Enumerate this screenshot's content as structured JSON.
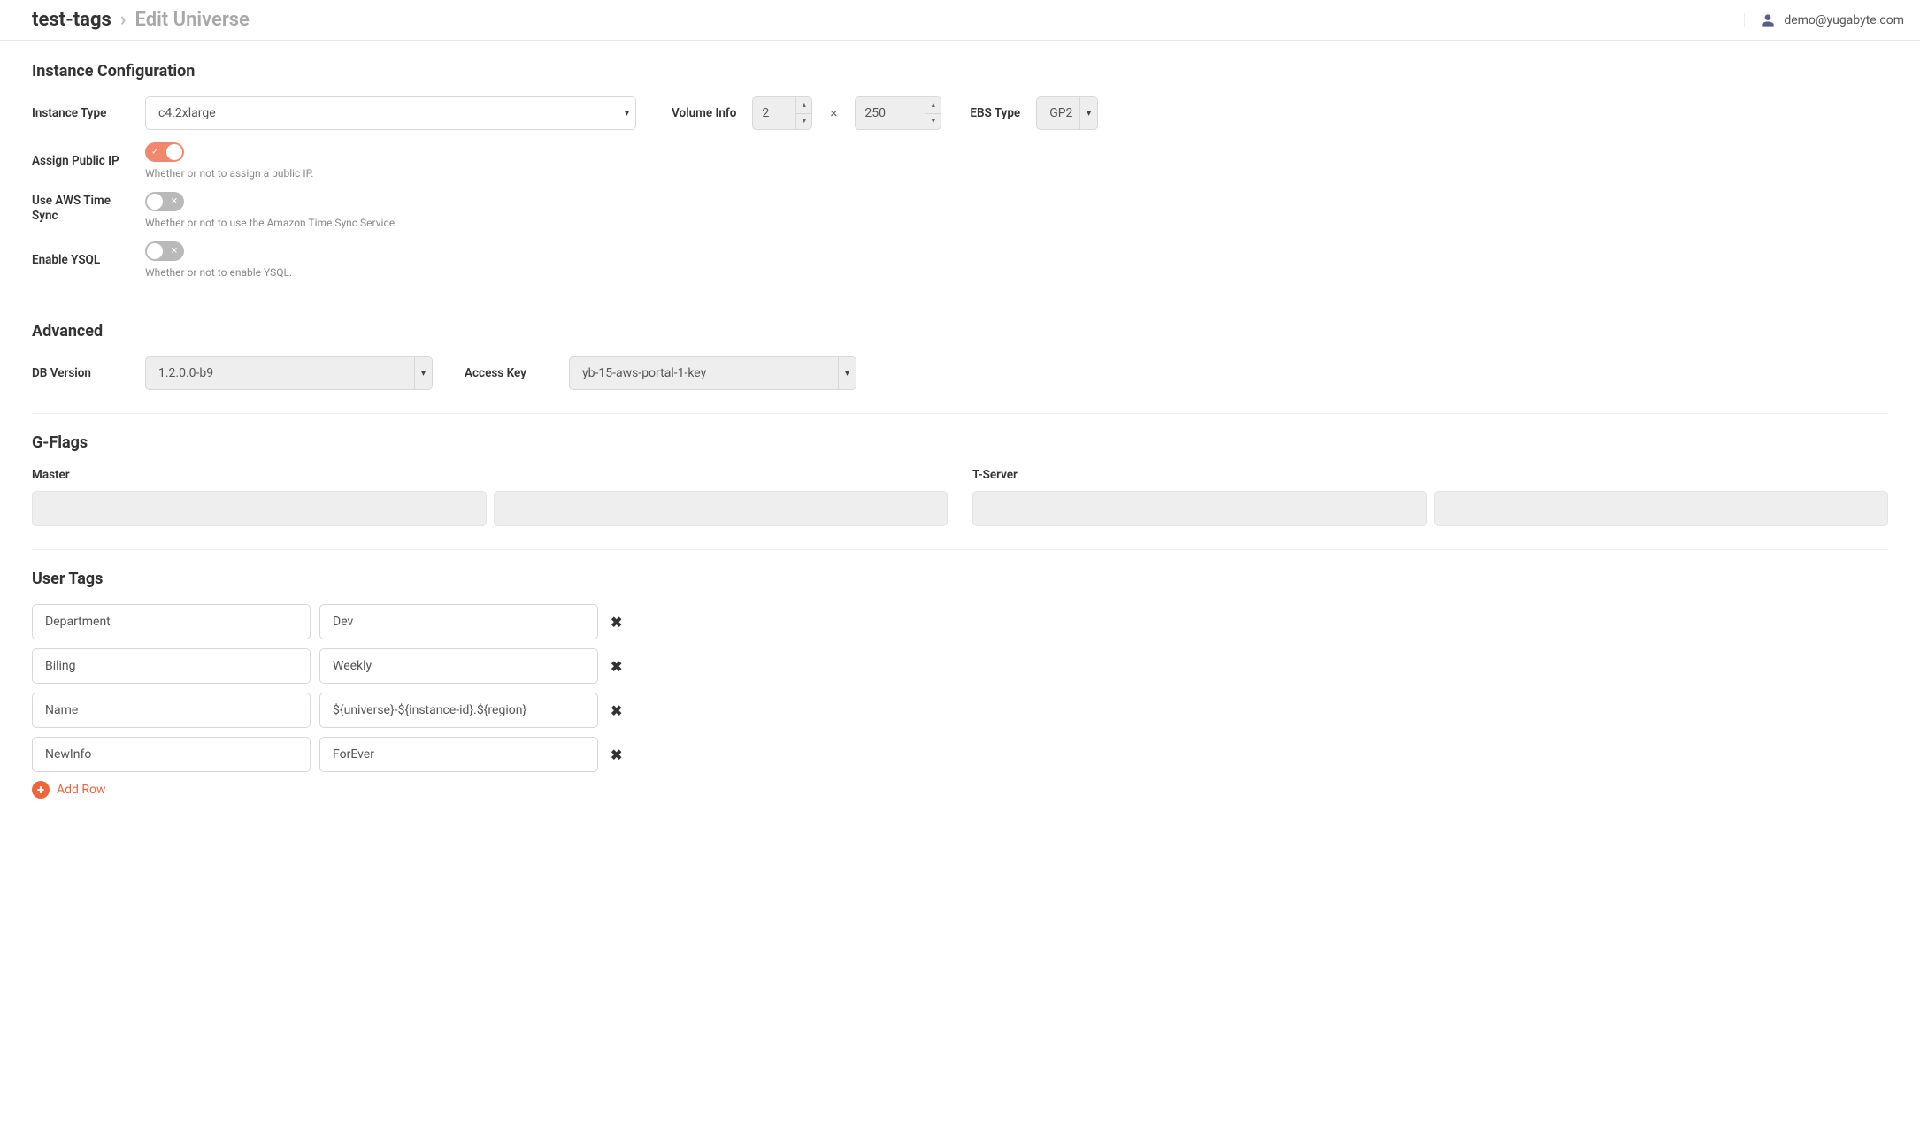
{
  "breadcrumb": {
    "universe": "test-tags",
    "action": "Edit Universe"
  },
  "user": {
    "email": "demo@yugabyte.com"
  },
  "sections": {
    "instance_config": "Instance Configuration",
    "advanced": "Advanced",
    "gflags": "G-Flags",
    "user_tags": "User Tags"
  },
  "instance": {
    "type_label": "Instance Type",
    "type_value": "c4.2xlarge",
    "volume_label": "Volume Info",
    "volume_count": "2",
    "volume_size": "250",
    "ebs_label": "EBS Type",
    "ebs_value": "GP2",
    "public_ip": {
      "label": "Assign Public IP",
      "helper": "Whether or not to assign a public IP.",
      "on": true
    },
    "aws_time": {
      "label": "Use AWS Time Sync",
      "helper": "Whether or not to use the Amazon Time Sync Service.",
      "on": false
    },
    "ysql": {
      "label": "Enable YSQL",
      "helper": "Whether or not to enable YSQL.",
      "on": false
    }
  },
  "advanced": {
    "db_label": "DB Version",
    "db_value": "1.2.0.0-b9",
    "ak_label": "Access Key",
    "ak_value": "yb-15-aws-portal-1-key"
  },
  "gflags": {
    "master_label": "Master",
    "tserver_label": "T-Server"
  },
  "user_tags": {
    "rows": [
      {
        "key": "Department",
        "value": "Dev"
      },
      {
        "key": "Biling",
        "value": "Weekly"
      },
      {
        "key": "Name",
        "value": "${universe}-${instance-id}.${region}"
      },
      {
        "key": "NewInfo",
        "value": "ForEver"
      }
    ],
    "add_label": "Add Row"
  }
}
